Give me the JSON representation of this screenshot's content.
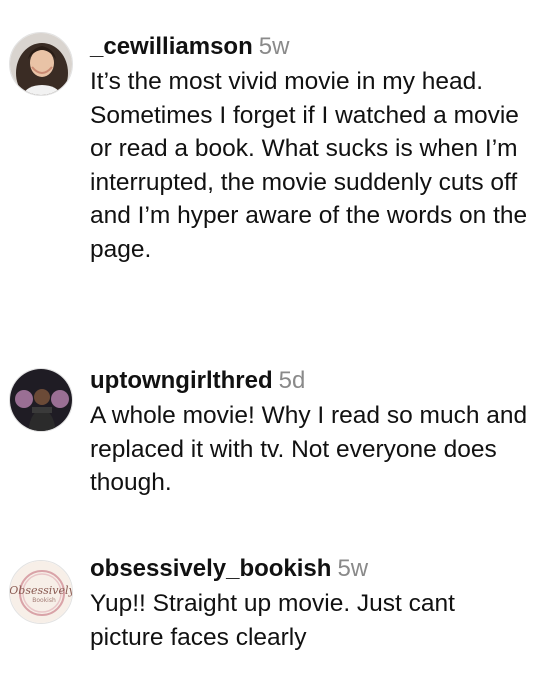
{
  "comments": [
    {
      "username": "_cewilliamson",
      "time": "5w",
      "text": "It’s the most vivid movie in my head. Sometimes I forget if I watched a movie or read a book. What sucks is when I’m interrupted, the movie suddenly cuts off and I’m hyper aware of the words on the page."
    },
    {
      "username": "uptowngirlthred",
      "time": "5d",
      "text": "A whole movie! Why I read so much and replaced it with tv. Not everyone does though."
    },
    {
      "username": "obsessively_bookish",
      "time": "5w",
      "text": "Yup!! Straight up movie. Just cant picture faces clearly",
      "avatar_logo_text": "Obsessively Bookish"
    }
  ]
}
